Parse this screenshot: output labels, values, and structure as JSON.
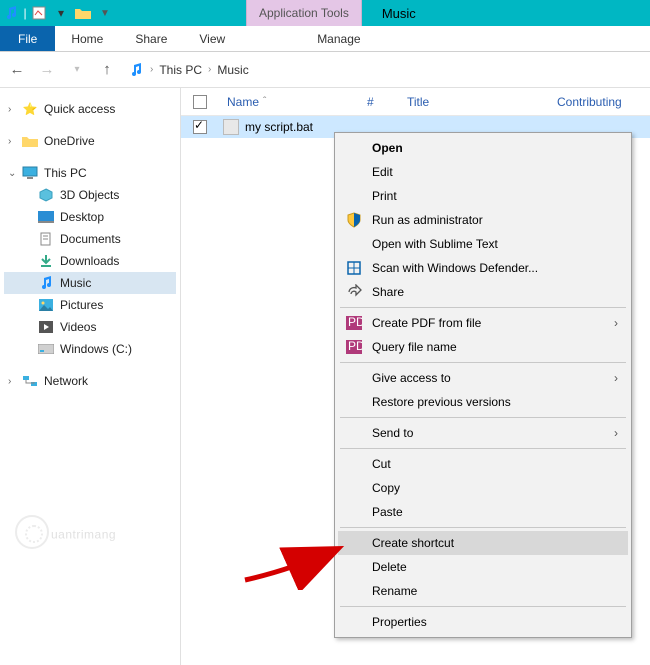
{
  "titlebar": {
    "contextual_label": "Application Tools",
    "window_title": "Music"
  },
  "ribbon": {
    "file": "File",
    "home": "Home",
    "share": "Share",
    "view": "View",
    "manage": "Manage"
  },
  "breadcrumb": {
    "root": "This PC",
    "current": "Music"
  },
  "columns": {
    "name": "Name",
    "number": "#",
    "title": "Title",
    "contributing": "Contributing"
  },
  "sidebar": {
    "quick_access": "Quick access",
    "onedrive": "OneDrive",
    "this_pc": "This PC",
    "objects_3d": "3D Objects",
    "desktop": "Desktop",
    "documents": "Documents",
    "downloads": "Downloads",
    "music": "Music",
    "pictures": "Pictures",
    "videos": "Videos",
    "windows_c": "Windows (C:)",
    "network": "Network"
  },
  "file_row": {
    "name": "my script.bat"
  },
  "context_menu": {
    "open": "Open",
    "edit": "Edit",
    "print": "Print",
    "run_admin": "Run as administrator",
    "sublime": "Open with Sublime Text",
    "defender": "Scan with Windows Defender...",
    "share": "Share",
    "create_pdf": "Create PDF from file",
    "query": "Query file name",
    "give_access": "Give access to",
    "restore": "Restore previous versions",
    "send_to": "Send to",
    "cut": "Cut",
    "copy": "Copy",
    "paste": "Paste",
    "create_shortcut": "Create shortcut",
    "delete": "Delete",
    "rename": "Rename",
    "properties": "Properties"
  },
  "watermark": "uantrimang"
}
